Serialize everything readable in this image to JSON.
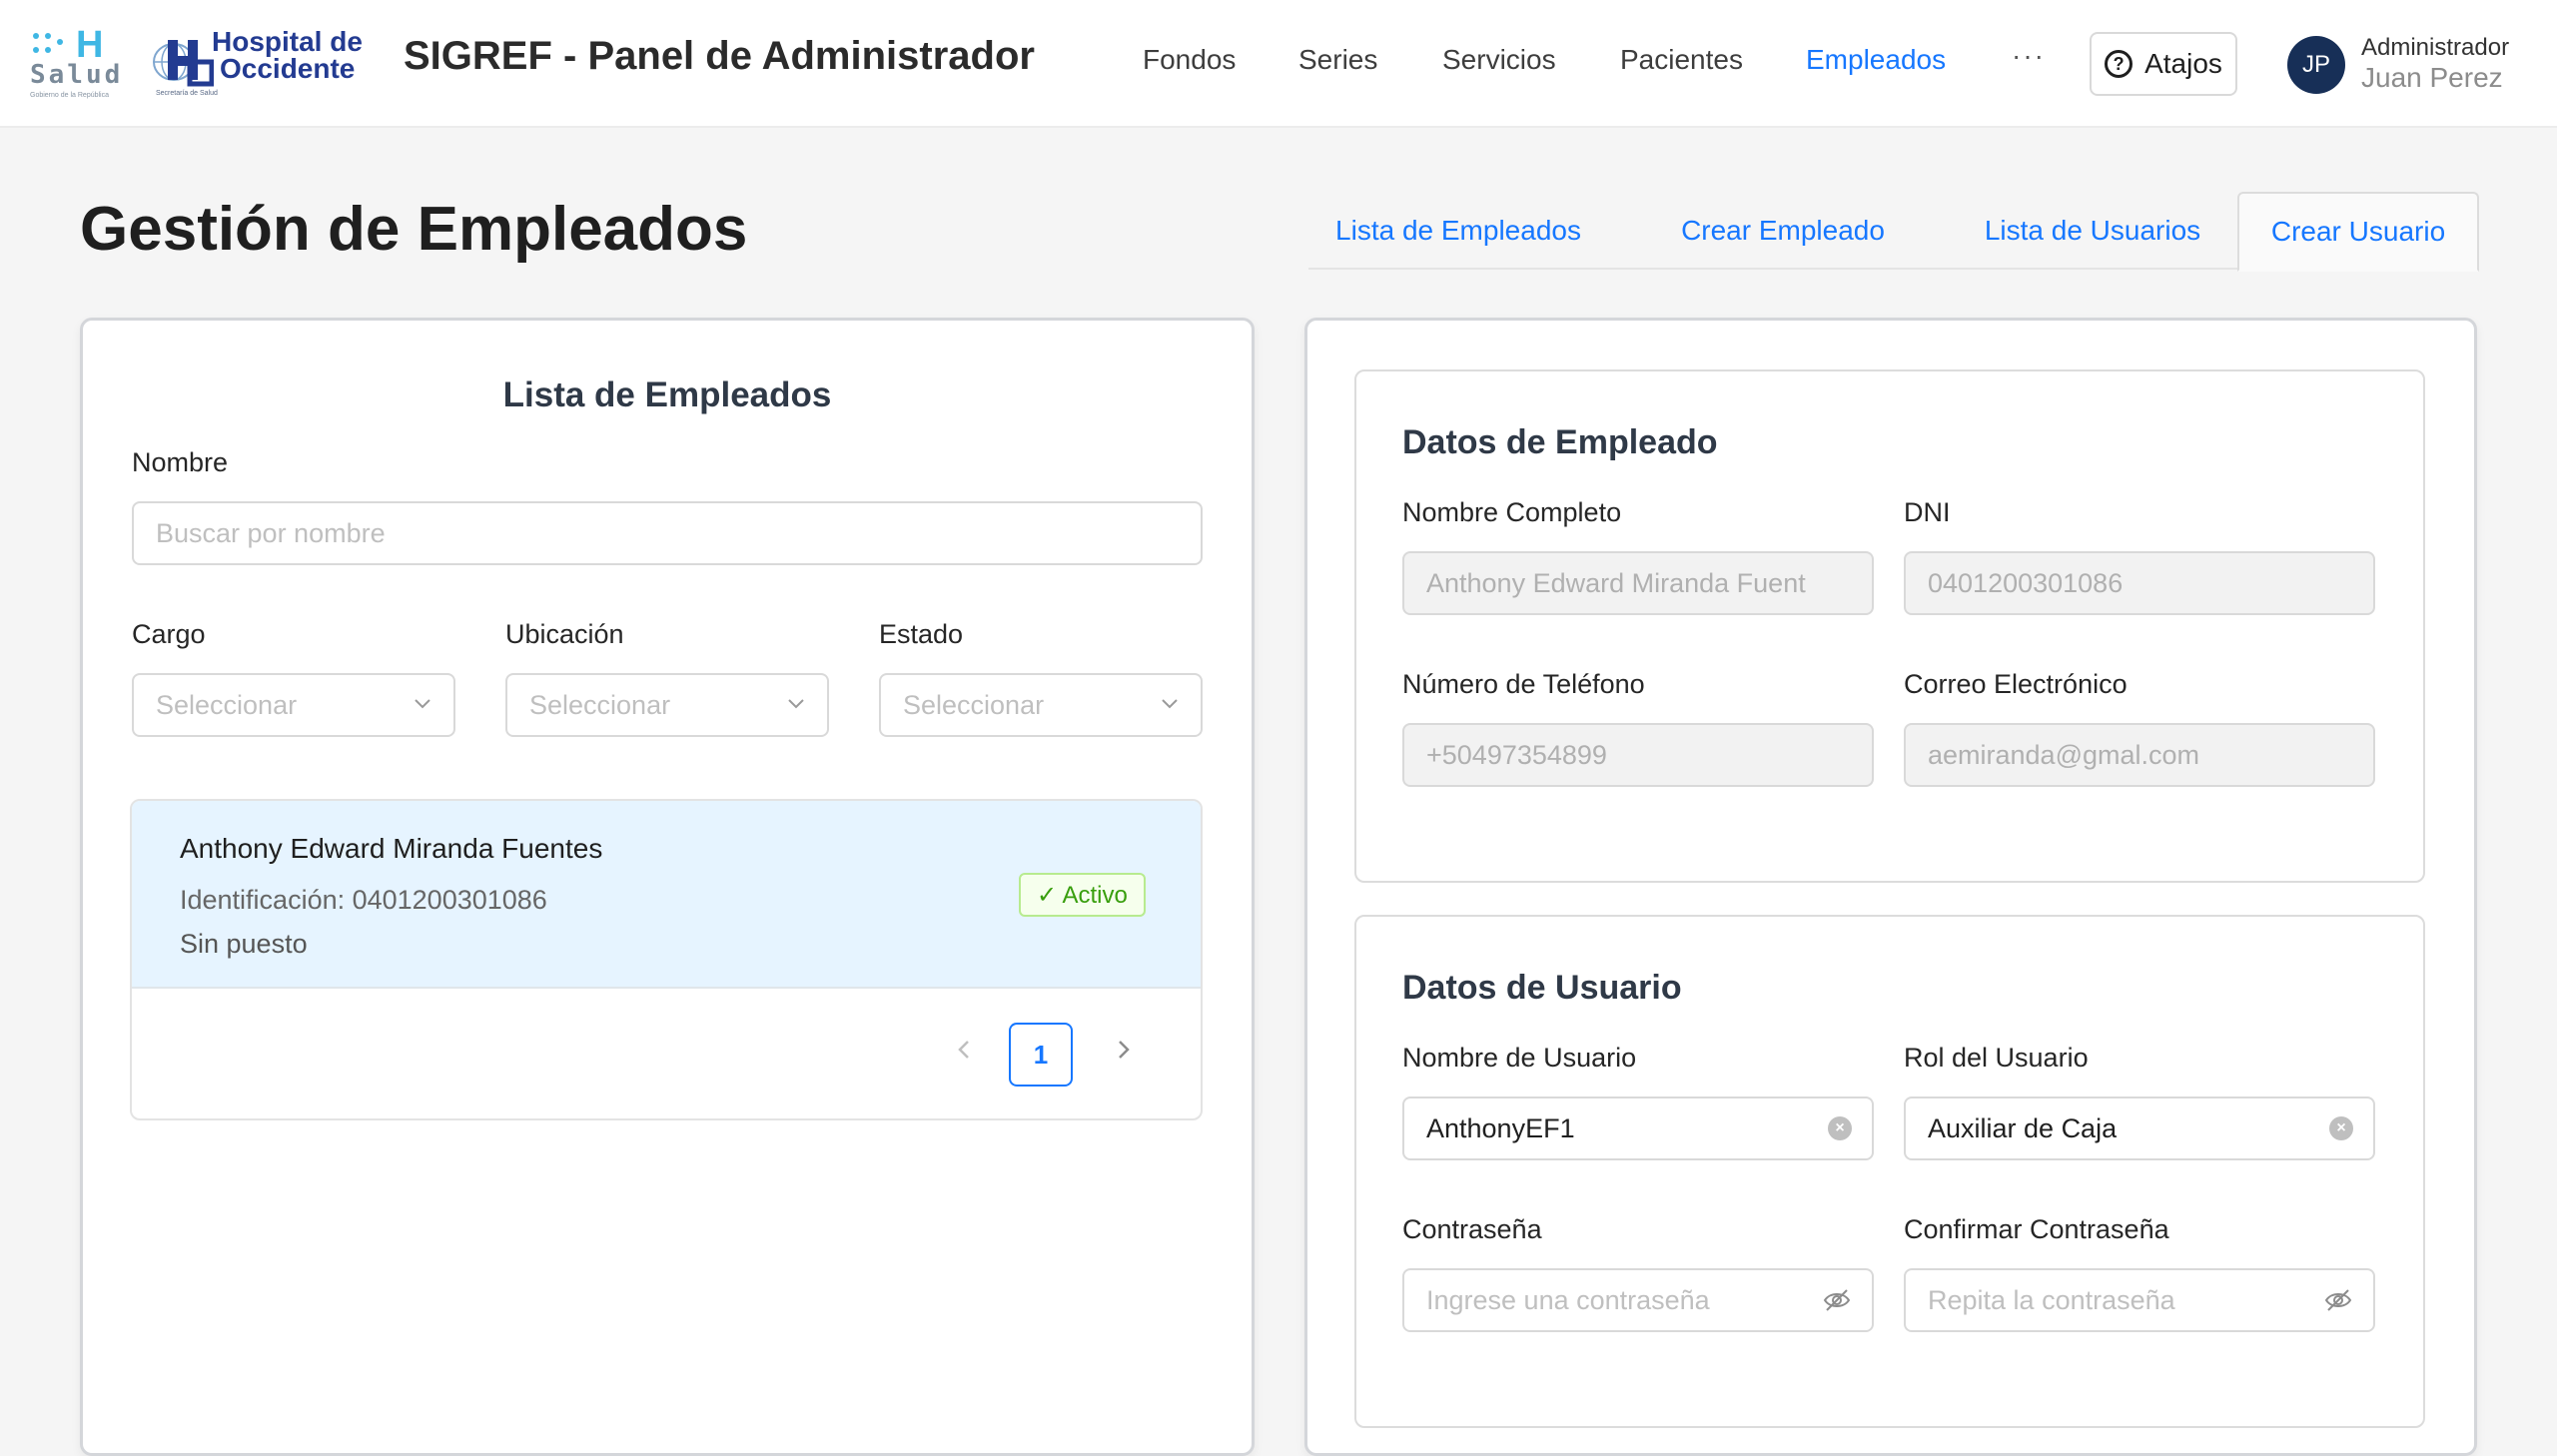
{
  "brand": {
    "salud_logo_text": "Salud",
    "salud_logo_tagline": "Gobierno de la República",
    "hospital_logo_line1": "Hospital de",
    "hospital_logo_line2": "Occidente",
    "hospital_logo_tagline": "Secretaría de Salud",
    "app_title": "SIGREF - Panel de Administrador"
  },
  "nav": {
    "items": [
      {
        "label": "Fondos",
        "active": false
      },
      {
        "label": "Series",
        "active": false
      },
      {
        "label": "Servicios",
        "active": false
      },
      {
        "label": "Pacientes",
        "active": false
      },
      {
        "label": "Empleados",
        "active": true
      }
    ],
    "more_label": "···",
    "shortcuts_label": "Atajos"
  },
  "user": {
    "initials": "JP",
    "role": "Administrador",
    "name": "Juan Perez"
  },
  "page": {
    "title": "Gestión de Empleados",
    "tabs": [
      {
        "label": "Lista de Empleados",
        "active": false
      },
      {
        "label": "Crear Empleado",
        "active": false
      },
      {
        "label": "Lista de Usuarios",
        "active": false
      },
      {
        "label": "Crear Usuario",
        "active": true
      }
    ]
  },
  "employee_list": {
    "title": "Lista de Empleados",
    "name_label": "Nombre",
    "name_placeholder": "Buscar por nombre",
    "filters": [
      {
        "label": "Cargo",
        "placeholder": "Seleccionar"
      },
      {
        "label": "Ubicación",
        "placeholder": "Seleccionar"
      },
      {
        "label": "Estado",
        "placeholder": "Seleccionar"
      }
    ],
    "items": [
      {
        "name": "Anthony Edward Miranda Fuentes",
        "identification": "Identificación: 0401200301086",
        "position": "Sin puesto",
        "status": "✓ Activo"
      }
    ],
    "pagination": {
      "current_page": "1"
    }
  },
  "employee_data": {
    "title": "Datos de Empleado",
    "full_name_label": "Nombre Completo",
    "full_name_value": "Anthony Edward Miranda Fuent",
    "dni_label": "DNI",
    "dni_value": "0401200301086",
    "phone_label": "Número de Teléfono",
    "phone_value": "+50497354899",
    "email_label": "Correo Electrónico",
    "email_value": "aemiranda@gmal.com"
  },
  "user_data": {
    "title": "Datos de Usuario",
    "username_label": "Nombre de Usuario",
    "username_value": "AnthonyEF1",
    "role_label": "Rol del Usuario",
    "role_value": "Auxiliar de Caja",
    "password_label": "Contraseña",
    "password_placeholder": "Ingrese una contraseña",
    "confirm_label": "Confirmar Contraseña",
    "confirm_placeholder": "Repita la contraseña"
  },
  "colors": {
    "accent": "#1677ff",
    "avatar_bg": "#172f57",
    "active_row_bg": "#e6f4ff",
    "status_green": "#389e0d"
  }
}
